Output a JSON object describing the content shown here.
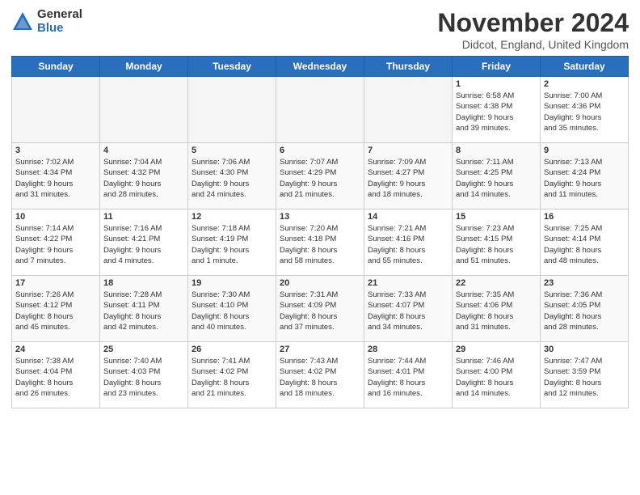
{
  "logo": {
    "general": "General",
    "blue": "Blue"
  },
  "title": "November 2024",
  "location": "Didcot, England, United Kingdom",
  "headers": [
    "Sunday",
    "Monday",
    "Tuesday",
    "Wednesday",
    "Thursday",
    "Friday",
    "Saturday"
  ],
  "weeks": [
    [
      {
        "day": "",
        "info": ""
      },
      {
        "day": "",
        "info": ""
      },
      {
        "day": "",
        "info": ""
      },
      {
        "day": "",
        "info": ""
      },
      {
        "day": "",
        "info": ""
      },
      {
        "day": "1",
        "info": "Sunrise: 6:58 AM\nSunset: 4:38 PM\nDaylight: 9 hours\nand 39 minutes."
      },
      {
        "day": "2",
        "info": "Sunrise: 7:00 AM\nSunset: 4:36 PM\nDaylight: 9 hours\nand 35 minutes."
      }
    ],
    [
      {
        "day": "3",
        "info": "Sunrise: 7:02 AM\nSunset: 4:34 PM\nDaylight: 9 hours\nand 31 minutes."
      },
      {
        "day": "4",
        "info": "Sunrise: 7:04 AM\nSunset: 4:32 PM\nDaylight: 9 hours\nand 28 minutes."
      },
      {
        "day": "5",
        "info": "Sunrise: 7:06 AM\nSunset: 4:30 PM\nDaylight: 9 hours\nand 24 minutes."
      },
      {
        "day": "6",
        "info": "Sunrise: 7:07 AM\nSunset: 4:29 PM\nDaylight: 9 hours\nand 21 minutes."
      },
      {
        "day": "7",
        "info": "Sunrise: 7:09 AM\nSunset: 4:27 PM\nDaylight: 9 hours\nand 18 minutes."
      },
      {
        "day": "8",
        "info": "Sunrise: 7:11 AM\nSunset: 4:25 PM\nDaylight: 9 hours\nand 14 minutes."
      },
      {
        "day": "9",
        "info": "Sunrise: 7:13 AM\nSunset: 4:24 PM\nDaylight: 9 hours\nand 11 minutes."
      }
    ],
    [
      {
        "day": "10",
        "info": "Sunrise: 7:14 AM\nSunset: 4:22 PM\nDaylight: 9 hours\nand 7 minutes."
      },
      {
        "day": "11",
        "info": "Sunrise: 7:16 AM\nSunset: 4:21 PM\nDaylight: 9 hours\nand 4 minutes."
      },
      {
        "day": "12",
        "info": "Sunrise: 7:18 AM\nSunset: 4:19 PM\nDaylight: 9 hours\nand 1 minute."
      },
      {
        "day": "13",
        "info": "Sunrise: 7:20 AM\nSunset: 4:18 PM\nDaylight: 8 hours\nand 58 minutes."
      },
      {
        "day": "14",
        "info": "Sunrise: 7:21 AM\nSunset: 4:16 PM\nDaylight: 8 hours\nand 55 minutes."
      },
      {
        "day": "15",
        "info": "Sunrise: 7:23 AM\nSunset: 4:15 PM\nDaylight: 8 hours\nand 51 minutes."
      },
      {
        "day": "16",
        "info": "Sunrise: 7:25 AM\nSunset: 4:14 PM\nDaylight: 8 hours\nand 48 minutes."
      }
    ],
    [
      {
        "day": "17",
        "info": "Sunrise: 7:26 AM\nSunset: 4:12 PM\nDaylight: 8 hours\nand 45 minutes."
      },
      {
        "day": "18",
        "info": "Sunrise: 7:28 AM\nSunset: 4:11 PM\nDaylight: 8 hours\nand 42 minutes."
      },
      {
        "day": "19",
        "info": "Sunrise: 7:30 AM\nSunset: 4:10 PM\nDaylight: 8 hours\nand 40 minutes."
      },
      {
        "day": "20",
        "info": "Sunrise: 7:31 AM\nSunset: 4:09 PM\nDaylight: 8 hours\nand 37 minutes."
      },
      {
        "day": "21",
        "info": "Sunrise: 7:33 AM\nSunset: 4:07 PM\nDaylight: 8 hours\nand 34 minutes."
      },
      {
        "day": "22",
        "info": "Sunrise: 7:35 AM\nSunset: 4:06 PM\nDaylight: 8 hours\nand 31 minutes."
      },
      {
        "day": "23",
        "info": "Sunrise: 7:36 AM\nSunset: 4:05 PM\nDaylight: 8 hours\nand 28 minutes."
      }
    ],
    [
      {
        "day": "24",
        "info": "Sunrise: 7:38 AM\nSunset: 4:04 PM\nDaylight: 8 hours\nand 26 minutes."
      },
      {
        "day": "25",
        "info": "Sunrise: 7:40 AM\nSunset: 4:03 PM\nDaylight: 8 hours\nand 23 minutes."
      },
      {
        "day": "26",
        "info": "Sunrise: 7:41 AM\nSunset: 4:02 PM\nDaylight: 8 hours\nand 21 minutes."
      },
      {
        "day": "27",
        "info": "Sunrise: 7:43 AM\nSunset: 4:02 PM\nDaylight: 8 hours\nand 18 minutes."
      },
      {
        "day": "28",
        "info": "Sunrise: 7:44 AM\nSunset: 4:01 PM\nDaylight: 8 hours\nand 16 minutes."
      },
      {
        "day": "29",
        "info": "Sunrise: 7:46 AM\nSunset: 4:00 PM\nDaylight: 8 hours\nand 14 minutes."
      },
      {
        "day": "30",
        "info": "Sunrise: 7:47 AM\nSunset: 3:59 PM\nDaylight: 8 hours\nand 12 minutes."
      }
    ]
  ]
}
